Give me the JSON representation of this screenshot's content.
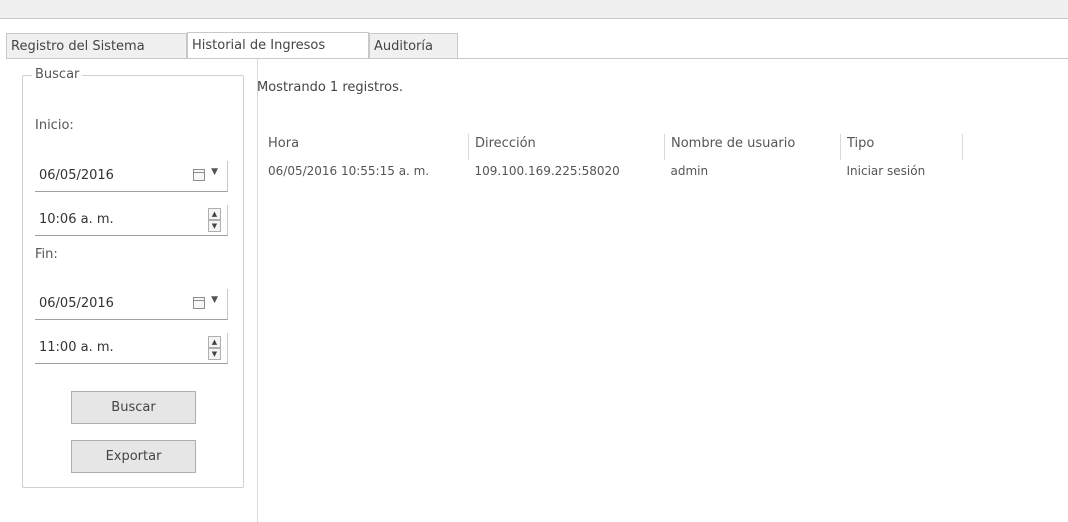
{
  "tabs": [
    {
      "label": "Registro del Sistema",
      "active": false
    },
    {
      "label": "Historial de Ingresos",
      "active": true
    },
    {
      "label": "Auditoría",
      "active": false
    }
  ],
  "search": {
    "group_title": "Buscar",
    "start_label": "Inicio:",
    "start_date": "06/05/2016",
    "start_time": "10:06 a. m.",
    "end_label": "Fin:",
    "end_date": "06/05/2016",
    "end_time": "11:00 a. m.",
    "search_button": "Buscar",
    "export_button": "Exportar"
  },
  "results": {
    "status": "Mostrando 1 registros.",
    "columns": [
      "Hora",
      "Dirección",
      "Nombre de usuario",
      "Tipo"
    ],
    "rows": [
      [
        "06/05/2016 10:55:15 a. m.",
        "109.100.169.225:58020",
        "admin",
        "Iniciar sesión"
      ]
    ]
  }
}
